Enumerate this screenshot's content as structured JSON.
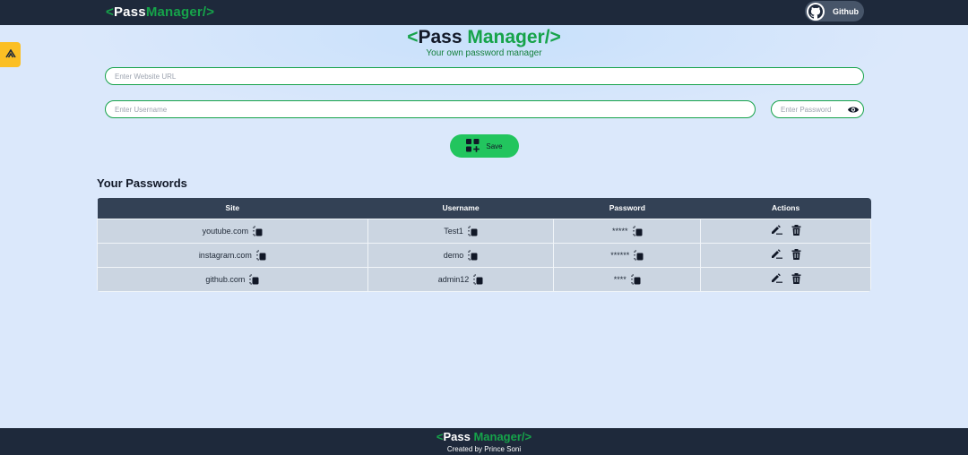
{
  "navbar": {
    "logo": {
      "lt": "<",
      "pass": "Pass",
      "manager": "Manager/",
      "gt": ">"
    },
    "github_label": "Github"
  },
  "header": {
    "title": {
      "lt": "<",
      "pass": "Pass",
      "manager": "Manager/",
      "gt": ">"
    },
    "subtitle": "Your own password manager"
  },
  "form": {
    "url_placeholder": "Enter Website URL",
    "username_placeholder": "Enter Username",
    "password_placeholder": "Enter Password",
    "save_label": "Save"
  },
  "passwords": {
    "section_title": "Your Passwords",
    "columns": [
      "Site",
      "Username",
      "Password",
      "Actions"
    ],
    "rows": [
      {
        "site": "youtube.com",
        "username": "Test1",
        "password": "*****"
      },
      {
        "site": "instagram.com",
        "username": "demo",
        "password": "******"
      },
      {
        "site": "github.com",
        "username": "admin12",
        "password": "****"
      }
    ]
  },
  "footer": {
    "logo": {
      "lt": "<",
      "pass": "Pass",
      "manager": "Manager/",
      "gt": ">"
    },
    "credit": "Created by Prince Soni"
  },
  "colors": {
    "navbar": "#1e293b",
    "accent": "#16a34a",
    "save_button": "#22c55e",
    "background": "#dbe8fb",
    "table_header": "#334155",
    "table_row": "#cbd5e1"
  },
  "icons": {
    "github": "github-icon",
    "eye": "eye-icon",
    "save": "add-grid-icon",
    "copy": "copy-icon",
    "edit": "edit-icon",
    "delete": "trash-icon",
    "side_tab": "extension-icon"
  }
}
